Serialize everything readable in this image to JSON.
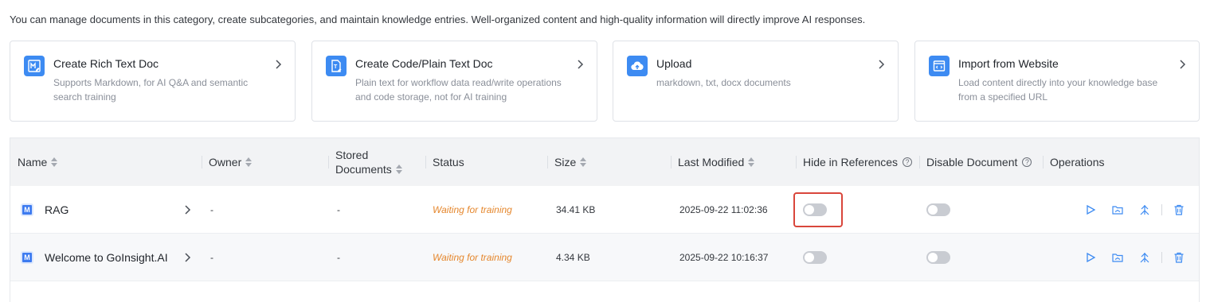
{
  "intro_text": "You can manage documents in this category, create subcategories, and maintain knowledge entries. Well-organized content and high-quality information will directly improve AI responses.",
  "cards": [
    {
      "icon": "markdown-doc-icon",
      "title": "Create Rich Text Doc",
      "desc": "Supports Markdown, for AI Q&A and semantic search training"
    },
    {
      "icon": "code-doc-icon",
      "title": "Create Code/Plain Text Doc",
      "desc": "Plain text for workflow data read/write operations and code storage, not for AI training"
    },
    {
      "icon": "cloud-upload-icon",
      "title": "Upload",
      "desc": "markdown, txt, docx documents"
    },
    {
      "icon": "website-import-icon",
      "title": "Import from Website",
      "desc": "Load content directly into your knowledge base from a specified URL"
    }
  ],
  "table": {
    "headers": {
      "name": "Name",
      "owner": "Owner",
      "stored_line1": "Stored",
      "stored_line2": "Documents",
      "status": "Status",
      "size": "Size",
      "modified": "Last Modified",
      "hide": "Hide in References",
      "disable": "Disable Document",
      "operations": "Operations"
    },
    "rows": [
      {
        "name": "RAG",
        "owner": "-",
        "stored": "-",
        "status": "Waiting for training",
        "size": "34.41 KB",
        "modified": "2025-09-22 11:02:36",
        "hide": false,
        "disable": false
      },
      {
        "name": "Welcome to GoInsight.AI",
        "owner": "-",
        "stored": "-",
        "status": "Waiting for training",
        "size": "4.34 KB",
        "modified": "2025-09-22 10:16:37",
        "hide": false,
        "disable": false
      }
    ],
    "file_icon_letter": "M"
  },
  "colors": {
    "accent": "#3d8bf2",
    "status_waiting": "#e5872d",
    "highlight": "#d9463b",
    "toggle_off": "#c9ccd2"
  }
}
